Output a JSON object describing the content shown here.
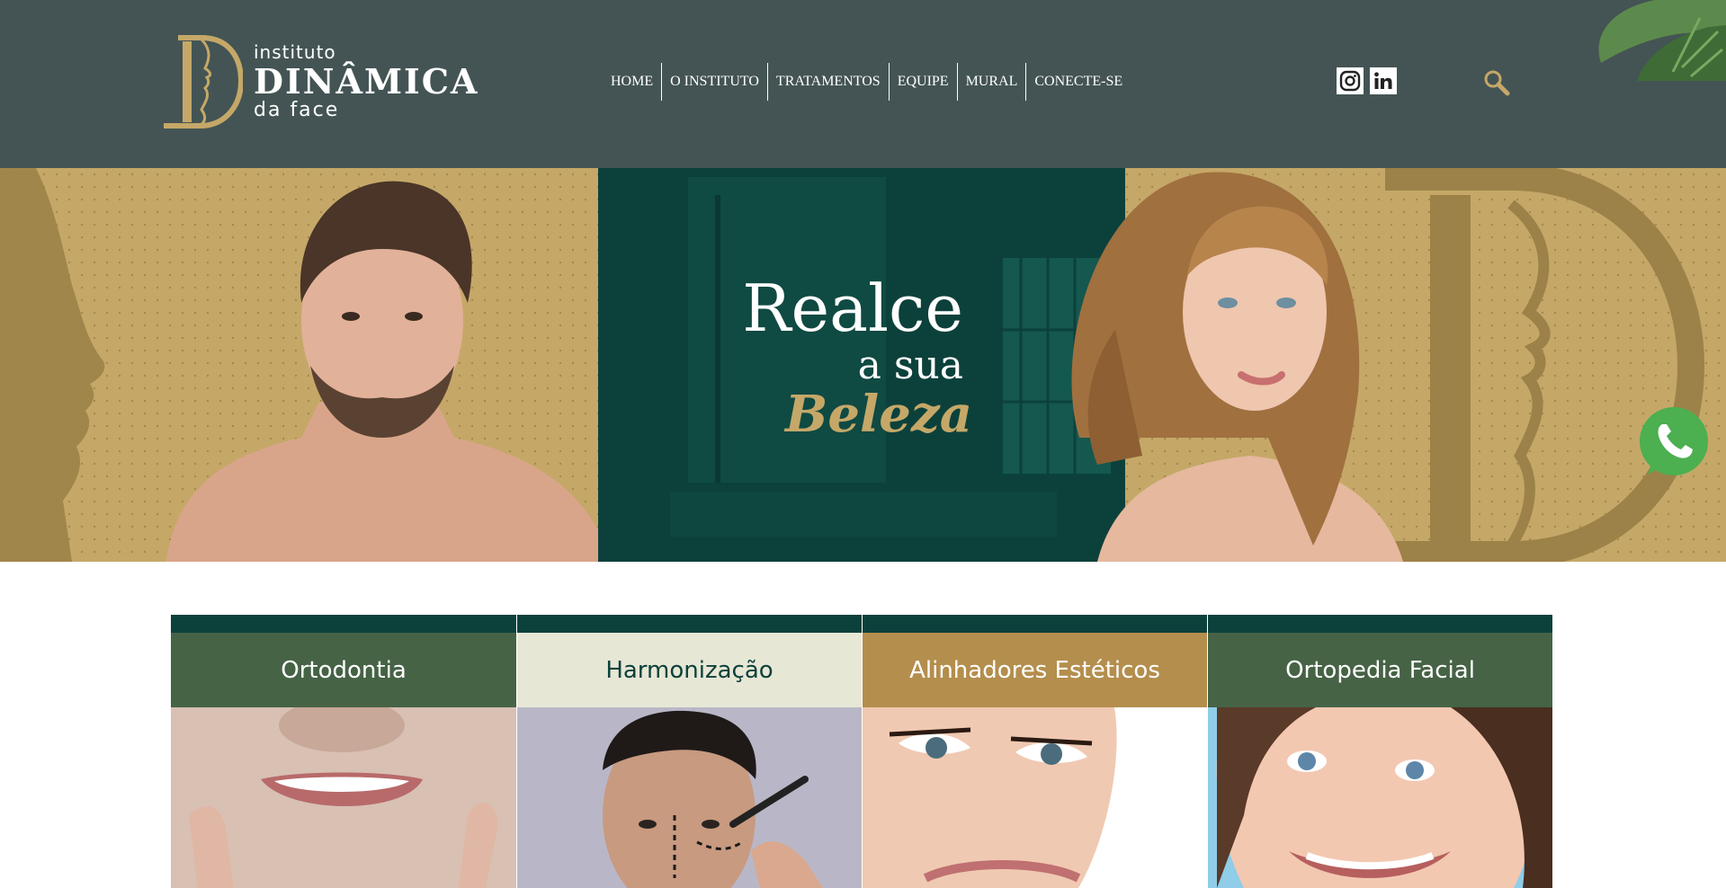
{
  "brand": {
    "line1": "instituto",
    "line2": "DINÂMICA",
    "line3": "da face"
  },
  "nav": {
    "items": [
      {
        "label": "HOME"
      },
      {
        "label": "O INSTITUTO"
      },
      {
        "label": "TRATAMENTOS"
      },
      {
        "label": "EQUIPE"
      },
      {
        "label": "MURAL"
      },
      {
        "label": "CONECTE-SE"
      }
    ]
  },
  "social": {
    "icons": [
      "instagram-icon",
      "linkedin-icon"
    ]
  },
  "hero": {
    "line1": "Realce",
    "line2": "a sua",
    "line3": "Beleza"
  },
  "cards": [
    {
      "title": "Ortodontia",
      "bg": "#466346",
      "color": "#ffffff"
    },
    {
      "title": "Harmonização",
      "bg": "#e7e7d6",
      "color": "#0c413b"
    },
    {
      "title": "Alinhadores Estéticos",
      "bg": "#b48e4d",
      "color": "#ffffff"
    },
    {
      "title": "Ortopedia Facial",
      "bg": "#466346",
      "color": "#ffffff"
    }
  ],
  "colors": {
    "header": "#445454",
    "gold": "#c5a868",
    "dark_green": "#0c413b",
    "whatsapp": "#4caf50"
  }
}
